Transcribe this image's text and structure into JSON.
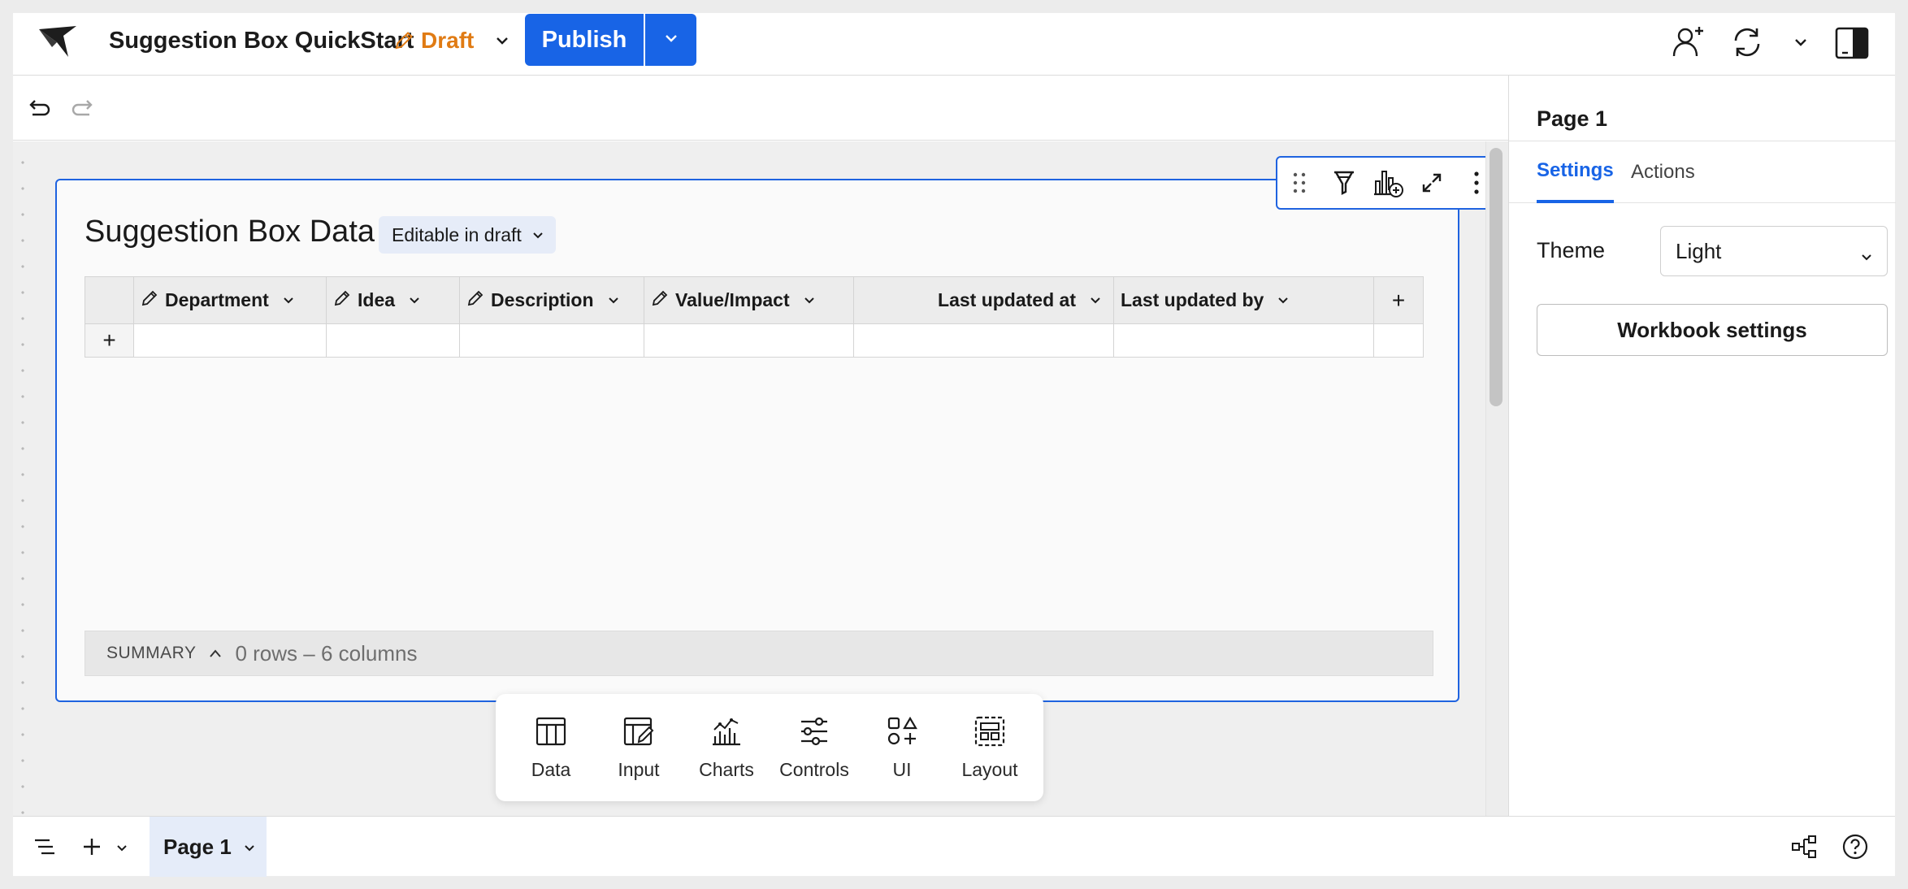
{
  "header": {
    "title": "Suggestion Box QuickStart",
    "status": "Draft",
    "publish_label": "Publish"
  },
  "element": {
    "title": "Suggestion Box Data",
    "badge": "Editable in draft"
  },
  "table": {
    "columns": [
      {
        "label": "Department",
        "editable": true
      },
      {
        "label": "Idea",
        "editable": true
      },
      {
        "label": "Description",
        "editable": true
      },
      {
        "label": "Value/Impact",
        "editable": true
      },
      {
        "label": "Last updated at",
        "editable": false
      },
      {
        "label": "Last updated by",
        "editable": false
      }
    ],
    "add_column": "+",
    "add_row": "+"
  },
  "summary": {
    "label": "SUMMARY",
    "count": "0 rows – 6 columns"
  },
  "add_panel": {
    "items": [
      {
        "label": "Data",
        "icon": "table-icon"
      },
      {
        "label": "Input",
        "icon": "input-table-icon"
      },
      {
        "label": "Charts",
        "icon": "chart-icon"
      },
      {
        "label": "Controls",
        "icon": "sliders-icon"
      },
      {
        "label": "UI",
        "icon": "shapes-icon"
      },
      {
        "label": "Layout",
        "icon": "layout-icon"
      }
    ]
  },
  "right_panel": {
    "title": "Page 1",
    "tabs": [
      "Settings",
      "Actions"
    ],
    "active_tab": "Settings",
    "theme_label": "Theme",
    "theme_value": "Light",
    "workbook_settings": "Workbook settings"
  },
  "bottom": {
    "page_tab": "Page 1"
  },
  "colors": {
    "accent": "#1864e6",
    "draft": "#e07b14"
  }
}
